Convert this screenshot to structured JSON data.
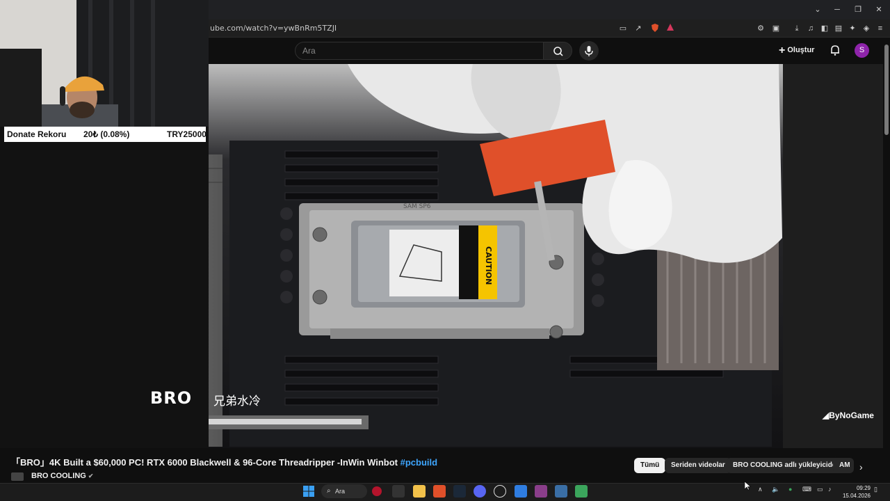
{
  "browser": {
    "url": "ube.com/watch?v=ywBnRm5TZJI",
    "window_controls": [
      "⌄",
      "─",
      "❐",
      "✕"
    ]
  },
  "youtube_header": {
    "search_placeholder": "Ara",
    "create_label": "Oluştur",
    "avatar_letter": "S"
  },
  "webcam_overlay": {
    "donate_label": "Donate Rekoru",
    "donate_progress": "20₺ (0.08%)",
    "donate_goal": "TRY25000"
  },
  "video": {
    "watermark_brand": "BRO",
    "watermark_cn": "兄弟水冷",
    "watermark_corner": "ByNoGame",
    "caution_label": "CAUTION",
    "socket_label": "SAM SP6"
  },
  "video_info": {
    "title": "「BRO」4K Built a $60,000 PC! RTX 6000 Blackwell & 96-Core Threadripper -InWin Winbot",
    "hashtag": "#pcbuild",
    "channel_name": "BRO COOLING",
    "chips": [
      "Tümü",
      "Seriden videolar",
      "BRO COOLING adlı yükleyiciden",
      "AM"
    ]
  },
  "taskbar": {
    "search_label": "Ara",
    "time": "09:29",
    "date": "15.04.2026"
  },
  "colors": {
    "accent_avatar": "#8e24aa",
    "hashtag": "#3ea6ff",
    "caution_yellow": "#f5c400",
    "orange_tool": "#e0502a"
  }
}
